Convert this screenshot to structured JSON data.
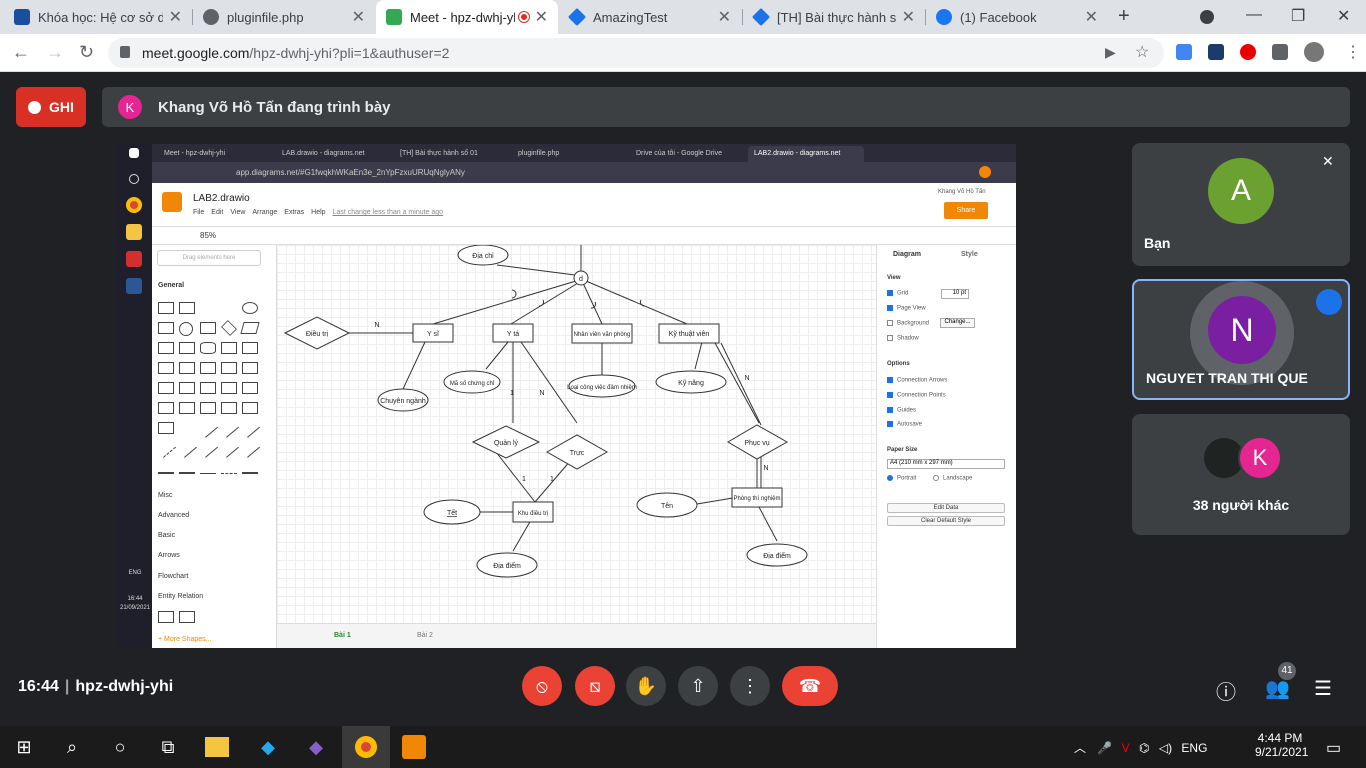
{
  "browser": {
    "tabs": [
      {
        "title": "Khóa học: Hệ cơ sở dữ",
        "color": "#1a4fa0",
        "close": "✕"
      },
      {
        "title": "pluginfile.php",
        "color": "#5f6368",
        "close": "✕"
      },
      {
        "title": "Meet - hpz-dwhj-yhi",
        "color": "#34a853",
        "close": "✕"
      },
      {
        "title": "AmazingTest",
        "color": "#1a73e8",
        "close": "✕"
      },
      {
        "title": "[TH] Bài thực hành số",
        "color": "#1a73e8",
        "close": "✕"
      },
      {
        "title": "(1) Facebook",
        "color": "#1877f2",
        "close": "✕"
      }
    ],
    "url_host": "meet.google.com",
    "url_path": "/hpz-dwhj-yhi?pli=1&authuser=2"
  },
  "meet": {
    "rec_label": "GHI",
    "presenter_initial": "K",
    "presenter_text": "Khang Võ Hồ Tấn đang trình bày",
    "meeting_time": "16:44",
    "meeting_code": "hpz-dwhj-yhi",
    "participants_count": "41",
    "tiles": [
      {
        "initial": "A",
        "name": "Bạn",
        "color": "#6aa131"
      },
      {
        "initial": "N",
        "name": "NGUYET TRAN THI QUE",
        "color": "#7b1fa2"
      },
      {
        "initial": "K",
        "name": "38 người khác",
        "color": "#e52592"
      }
    ]
  },
  "shared": {
    "inner_tabs": [
      "Meet - hpz-dwhj-yhi",
      "LAB.drawio - diagrams.net",
      "[TH] Bài thực hành số 01",
      "pluginfile.php",
      "Drive của tôi - Google Drive",
      "LAB2.drawio - diagrams.net"
    ],
    "inner_url": "app.diagrams.net/#G1fwqkhWKaEn3e_2nYpFzxuURUqNglyANy",
    "doc_title": "LAB2.drawio",
    "menu": [
      "File",
      "Edit",
      "View",
      "Arrange",
      "Extras",
      "Help"
    ],
    "last_change": "Last change less than a minute ago",
    "user": "Khang Võ Hồ Tấn",
    "share": "Share",
    "zoom": "85%",
    "search_placeholder": "Drag elements here",
    "sections": [
      "General",
      "Misc",
      "Advanced",
      "Basic",
      "Arrows",
      "Flowchart",
      "Entity Relation"
    ],
    "more_shapes": "+ More Shapes...",
    "pages": [
      "Bài 1",
      "Bài 2"
    ],
    "win_time": "16:44",
    "win_date": "21/09/2021",
    "win_lang": "ENG",
    "right_panel": {
      "tabs": [
        "Diagram",
        "Style"
      ],
      "view": "View",
      "grid": "Grid",
      "grid_size": "10 pt",
      "page_view": "Page View",
      "background": "Background",
      "change": "Change...",
      "shadow": "Shadow",
      "options": "Options",
      "connection_arrows": "Connection Arrows",
      "connection_points": "Connection Points",
      "guides": "Guides",
      "autosave": "Autosave",
      "paper_size": "Paper Size",
      "paper": "A4 (210 mm x 297 mm)",
      "portrait": "Portrait",
      "landscape": "Landscape",
      "edit_data": "Edit Data",
      "clear_style": "Clear Default Style"
    },
    "diagram": {
      "d": "d",
      "dia_chi_top": "Địa chỉ",
      "dieu_tri": "Điều trị",
      "y_si": "Y sĩ",
      "y_ta": "Y tá",
      "nhan_vien": "Nhân viên văn phòng",
      "ky_thuat_vien": "Kỹ thuật viên",
      "chuyen_nganh": "Chuyên ngành",
      "ma_so": "Mã số chứng chỉ",
      "loai_cong_viec": "Loại công việc đảm nhiệm",
      "ky_nang": "Kỹ năng",
      "quan_ly": "Quản lý",
      "truc": "Trực",
      "phuc_vu": "Phục vụ",
      "tet": "Tết",
      "khu_dieu_tri": "Khu điều trị",
      "ten": "Tên",
      "phong_thi_nghiem": "Phòng thí nghiệm",
      "dia_diem_1": "Địa điểm",
      "dia_diem_2": "Địa điểm",
      "card_n1": "N",
      "card_1a": "1",
      "card_n2": "N",
      "card_1b": "1",
      "card_1c": "1",
      "card_n3": "N",
      "card_n4": "N"
    }
  },
  "taskbar": {
    "time": "4:44 PM",
    "date": "9/21/2021",
    "lang": "ENG"
  }
}
